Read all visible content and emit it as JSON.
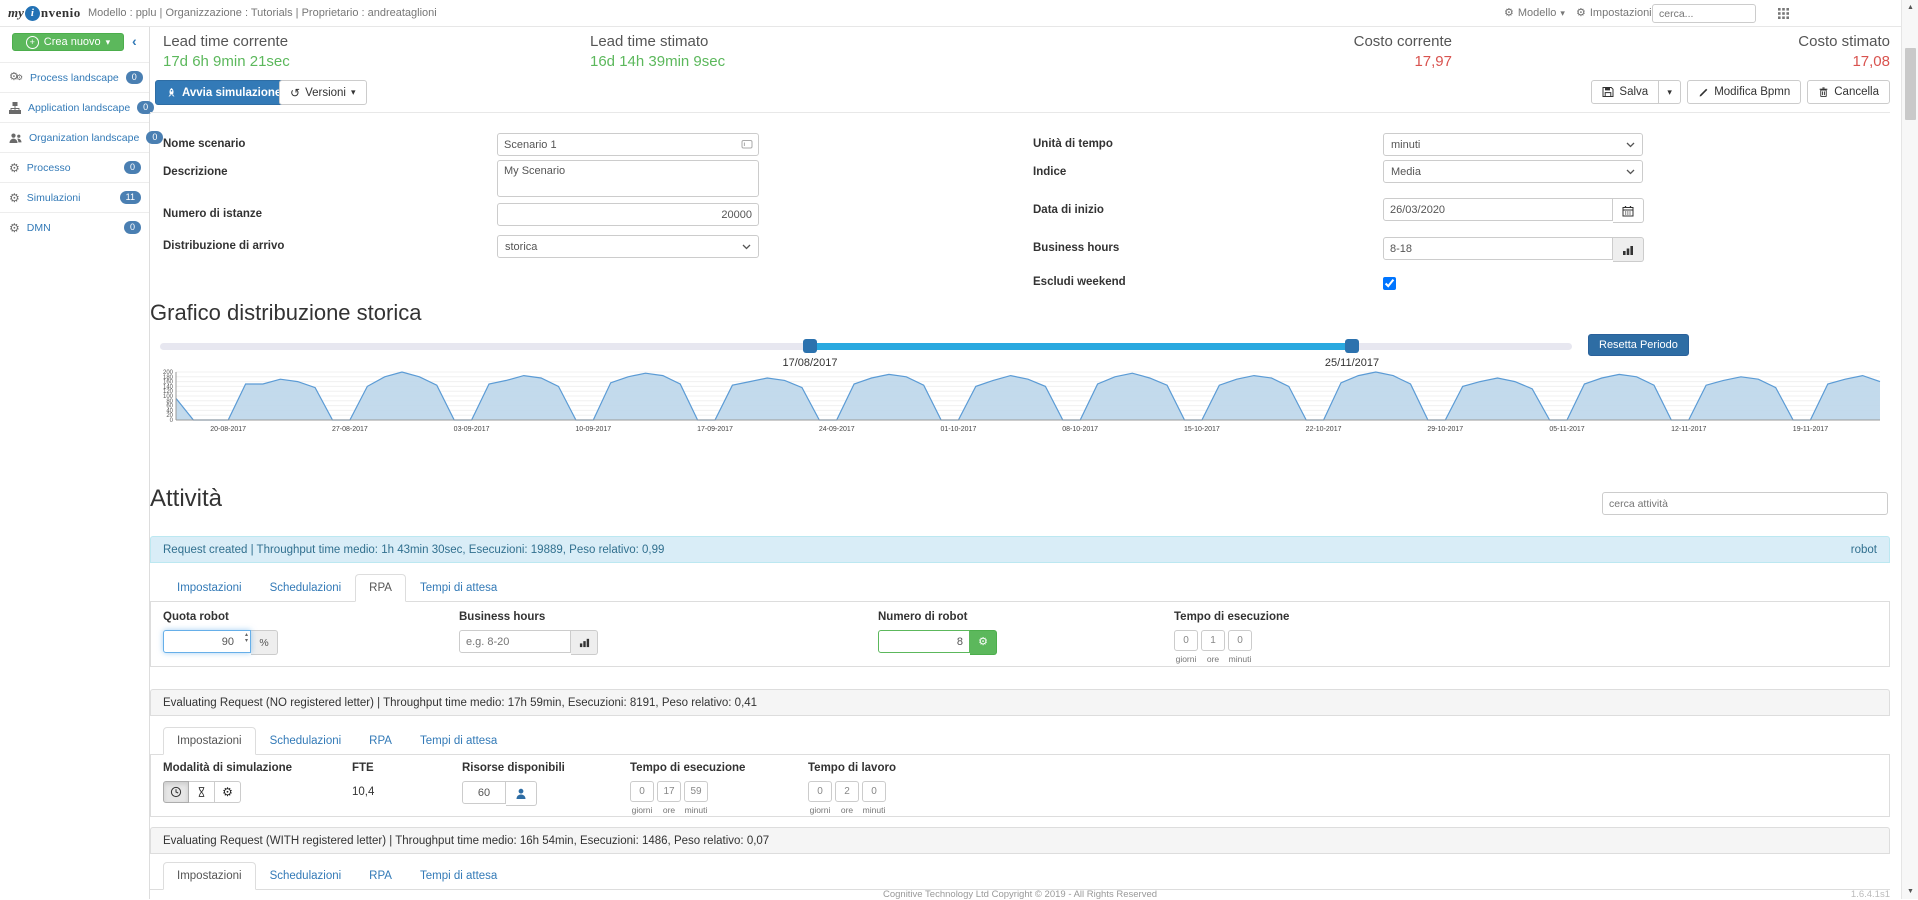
{
  "icons": {
    "gear": "⚙",
    "caret_down": "▾",
    "undo": "↺",
    "chevron_left": "‹",
    "scroll_up": "▲",
    "scroll_down": "▼",
    "plus": "+",
    "spinner_up": "▴",
    "spinner_down": "▾"
  },
  "navbar": {
    "logo_my": "my",
    "logo_i": "i",
    "logo_rest": "nvenio",
    "context": "Modello : pplu | Organizzazione : Tutorials | Proprietario : andreataglioni",
    "model_menu": "Modello",
    "settings": "Impostazioni",
    "search_placeholder": "cerca..."
  },
  "sidebar": {
    "create_button": "Crea nuovo",
    "items": [
      {
        "label": "Process landscape",
        "count": "0"
      },
      {
        "label": "Application landscape",
        "count": "0"
      },
      {
        "label": "Organization landscape",
        "count": "0"
      },
      {
        "label": "Processo",
        "count": "0"
      },
      {
        "label": "Simulazioni",
        "count": "11"
      },
      {
        "label": "DMN",
        "count": "0"
      }
    ]
  },
  "stats": {
    "lead_current_label": "Lead time corrente",
    "lead_current_value": "17d 6h 9min 21sec",
    "lead_est_label": "Lead time stimato",
    "lead_est_value": "16d 14h 39min 9sec",
    "cost_current_label": "Costo corrente",
    "cost_current_value": "17,97",
    "cost_est_label": "Costo stimato",
    "cost_est_value": "17,08",
    "positive_color": "#5cb85c",
    "negative_color": "#d9534f"
  },
  "toolbar": {
    "start": "Avvia simulazione",
    "versions": "Versioni",
    "save": "Salva",
    "edit": "Modifica Bpmn",
    "delete": "Cancella"
  },
  "form": {
    "nome_label": "Nome scenario",
    "nome_value": "Scenario 1",
    "descrizione_label": "Descrizione",
    "descrizione_value": "My Scenario",
    "istanze_label": "Numero di istanze",
    "istanze_value": "20000",
    "distribuzione_label": "Distribuzione di arrivo",
    "distribuzione_value": "storica",
    "unita_label": "Unità di tempo",
    "unita_value": "minuti",
    "indice_label": "Indice",
    "indice_value": "Media",
    "data_label": "Data di inizio",
    "data_value": "26/03/2020",
    "bh_label": "Business hours",
    "bh_value": "8-18",
    "weekend_label": "Escludi weekend"
  },
  "histogram": {
    "title": "Grafico distribuzione storica",
    "reset_button": "Resetta Periodo",
    "range_start": "17/08/2017",
    "range_end": "25/11/2017"
  },
  "chart_data": {
    "type": "area",
    "title": "Grafico distribuzione storica",
    "ylim": [
      0,
      200
    ],
    "ytick_step": 20,
    "x_labels": [
      "20-08-2017",
      "27-08-2017",
      "03-09-2017",
      "10-09-2017",
      "17-09-2017",
      "24-09-2017",
      "01-10-2017",
      "08-10-2017",
      "15-10-2017",
      "22-10-2017",
      "29-10-2017",
      "05-11-2017",
      "12-11-2017",
      "19-11-2017"
    ],
    "label_start_index": 3,
    "label_step": 7,
    "line_color": "#5b9bd5",
    "fill_color": "#bcd6ea",
    "daily_values": [
      90,
      0,
      0,
      0,
      150,
      150,
      170,
      160,
      135,
      0,
      0,
      140,
      180,
      200,
      180,
      145,
      0,
      0,
      150,
      165,
      185,
      175,
      140,
      0,
      0,
      155,
      180,
      195,
      185,
      150,
      0,
      0,
      145,
      160,
      175,
      165,
      135,
      0,
      0,
      150,
      175,
      190,
      180,
      145,
      0,
      0,
      140,
      165,
      185,
      170,
      140,
      0,
      0,
      150,
      180,
      195,
      175,
      145,
      0,
      0,
      145,
      170,
      185,
      175,
      140,
      0,
      0,
      155,
      185,
      200,
      185,
      150,
      0,
      0,
      140,
      160,
      175,
      160,
      130,
      0,
      0,
      150,
      175,
      190,
      180,
      145,
      0,
      0,
      145,
      165,
      180,
      170,
      135,
      0,
      0,
      150,
      170,
      185,
      160
    ]
  },
  "attivita": {
    "title": "Attività",
    "search_placeholder": "cerca attività",
    "tabs": [
      "Impostazioni",
      "Schedulazioni",
      "RPA",
      "Tempi di attesa"
    ],
    "activities": [
      {
        "header": "Request created | Throughput time medio: 1h 43min 30sec, Esecuzioni: 19889, Peso relativo: 0,99",
        "badge": "robot"
      },
      {
        "header": "Evaluating Request (NO registered letter) | Throughput time medio: 17h 59min, Esecuzioni: 8191, Peso relativo: 0,41"
      },
      {
        "header": "Evaluating Request (WITH registered letter) | Throughput time medio: 16h 54min, Esecuzioni: 1486, Peso relativo: 0,07"
      }
    ],
    "rpa_panel": {
      "quota_label": "Quota robot",
      "quota_value": "90",
      "quota_addon": "%",
      "bh_label": "Business hours",
      "bh_placeholder": "e.g. 8-20",
      "robots_label": "Numero di robot",
      "robots_value": "8",
      "exec_label": "Tempo di esecuzione",
      "exec_values": [
        "0",
        "1",
        "0"
      ],
      "time_units": [
        "giorni",
        "ore",
        "minuti"
      ]
    },
    "impostazioni_panel": {
      "modalita_label": "Modalità di simulazione",
      "fte_label": "FTE",
      "fte_value": "10,4",
      "risorse_label": "Risorse disponibili",
      "risorse_value": "60",
      "exec_label": "Tempo di esecuzione",
      "exec_values": [
        "0",
        "17",
        "59"
      ],
      "lavoro_label": "Tempo di lavoro",
      "lavoro_values": [
        "0",
        "2",
        "0"
      ],
      "time_units": [
        "giorni",
        "ore",
        "minuti"
      ]
    }
  },
  "footer": {
    "copyright": "Cognitive Technology Ltd Copyright © 2019 - All Rights Reserved",
    "version": "1.6.4.1s1"
  }
}
